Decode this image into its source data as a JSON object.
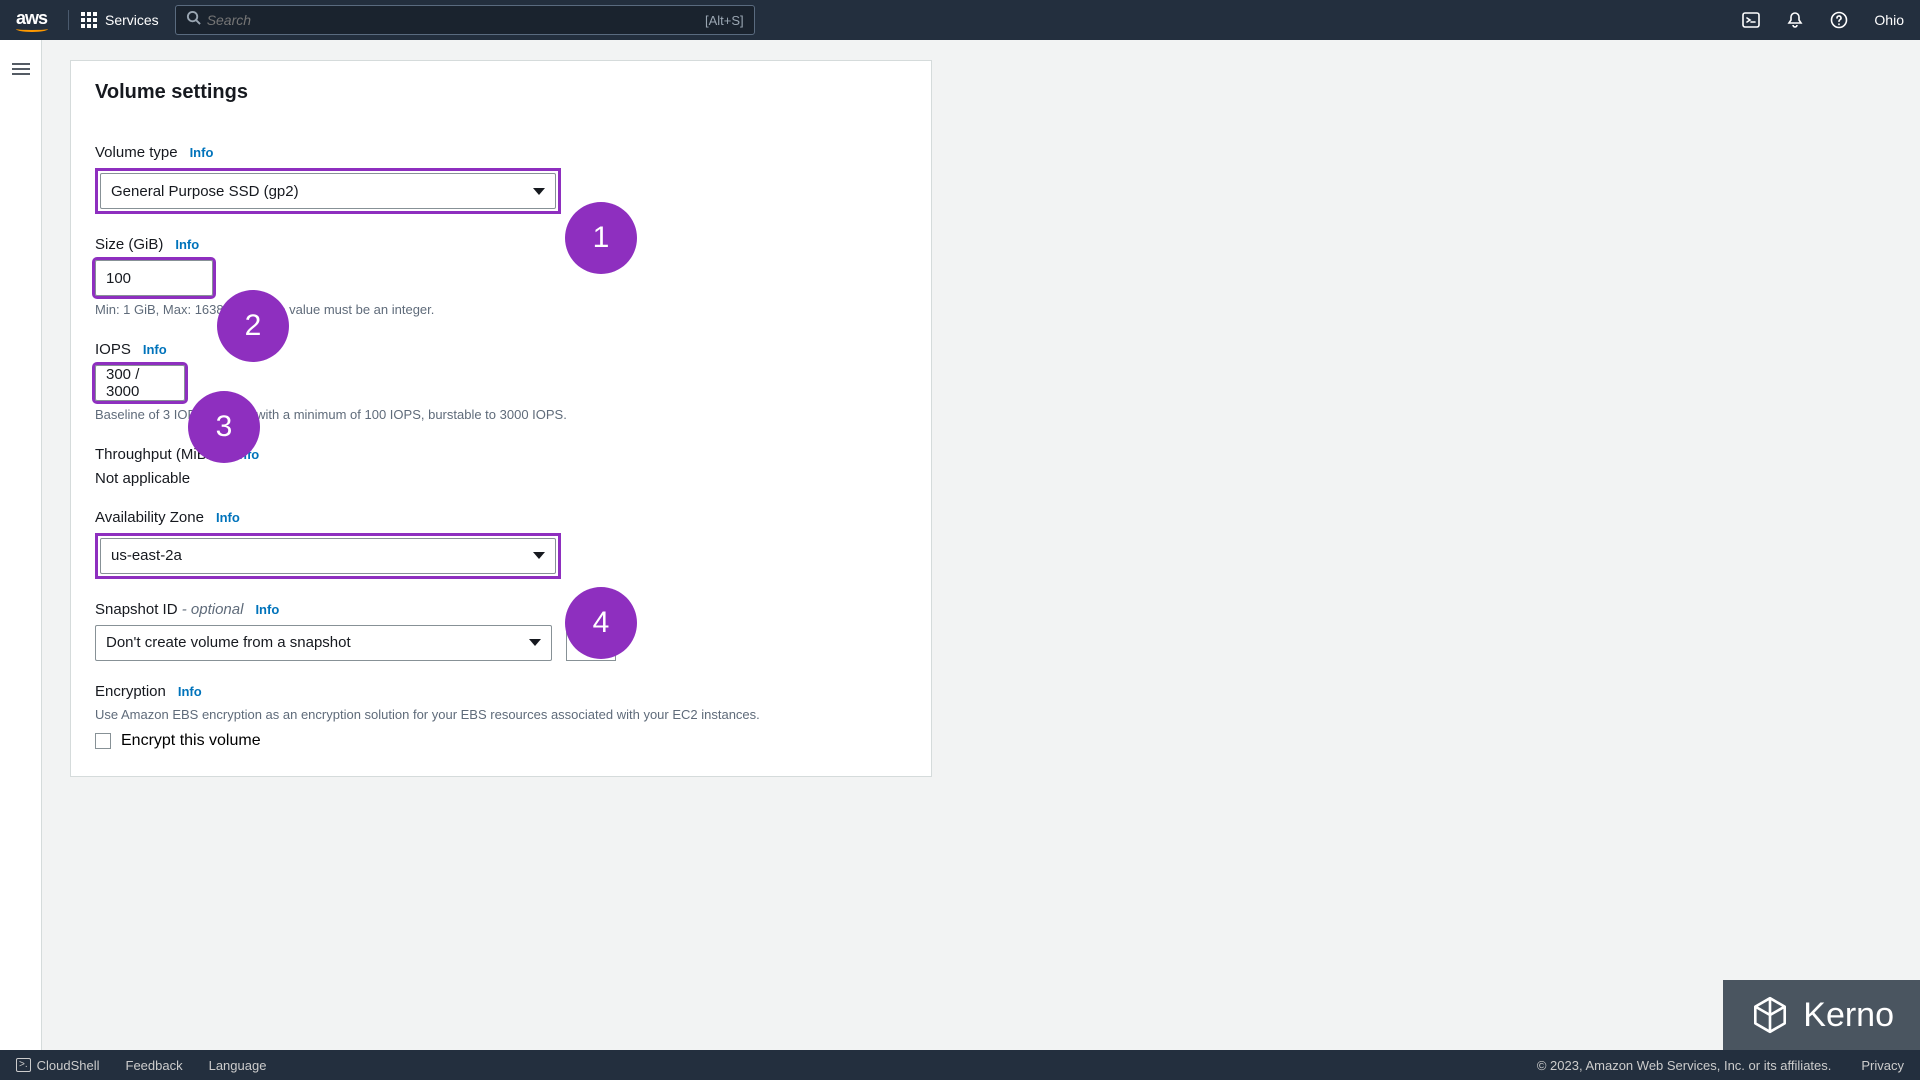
{
  "nav": {
    "services_label": "Services",
    "search_placeholder": "Search",
    "search_shortcut": "[Alt+S]",
    "region": "Ohio"
  },
  "panel": {
    "title": "Volume settings",
    "info": "Info",
    "volume_type": {
      "label": "Volume type",
      "value": "General Purpose SSD (gp2)"
    },
    "size": {
      "label": "Size (GiB)",
      "value": "100",
      "helper": "Min: 1 GiB, Max: 16384 GiB. The value must be an integer."
    },
    "iops": {
      "label": "IOPS",
      "value": "300 / 3000",
      "helper": "Baseline of 3 IOPS per GiB with a minimum of 100 IOPS, burstable to 3000 IOPS."
    },
    "throughput": {
      "label": "Throughput (MiB/s)",
      "value": "Not applicable"
    },
    "az": {
      "label": "Availability Zone",
      "value": "us-east-2a"
    },
    "snapshot": {
      "label": "Snapshot ID",
      "optional": " - optional",
      "value": "Don't create volume from a snapshot"
    },
    "encryption": {
      "label": "Encryption",
      "helper": "Use Amazon EBS encryption as an encryption solution for your EBS resources associated with your EC2 instances.",
      "checkbox": "Encrypt this volume"
    }
  },
  "badges": {
    "b1": "1",
    "b2": "2",
    "b3": "3",
    "b4": "4"
  },
  "footer": {
    "cloudshell": "CloudShell",
    "feedback": "Feedback",
    "language": "Language",
    "copyright": "© 2023, Amazon Web Services, Inc. or its affiliates.",
    "privacy": "Privacy"
  },
  "watermark": "Kerno"
}
